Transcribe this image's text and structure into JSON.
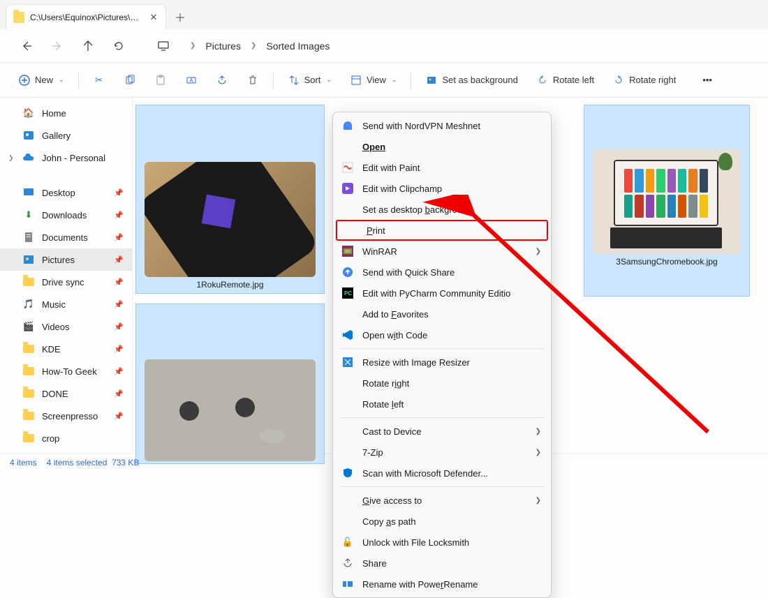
{
  "tab": {
    "title": "C:\\Users\\Equinox\\Pictures\\Sor"
  },
  "breadcrumb": {
    "seg1": "Pictures",
    "seg2": "Sorted Images"
  },
  "toolbar": {
    "new": "New",
    "sort": "Sort",
    "view": "View",
    "bg": "Set as background",
    "rotl": "Rotate left",
    "rotr": "Rotate right"
  },
  "side": {
    "home": "Home",
    "gallery": "Gallery",
    "john": "John - Personal",
    "desktop": "Desktop",
    "downloads": "Downloads",
    "documents": "Documents",
    "pictures": "Pictures",
    "drive": "Drive sync",
    "music": "Music",
    "videos": "Videos",
    "kde": "KDE",
    "htg": "How-To Geek",
    "done": "DONE",
    "sp": "Screenpresso",
    "crop": "crop"
  },
  "thumbs": {
    "roku": "1RokuRemote.jpg",
    "samsung": "3SamsungChromebook.jpg"
  },
  "status": {
    "items": "4 items",
    "sel": "4 items selected",
    "size": "733 KB"
  },
  "ctx": {
    "nordvpn": "Send with NordVPN Meshnet",
    "open": "Open",
    "paint": "Edit with Paint",
    "clip": "Edit with Clipchamp",
    "bg": "Set as desktop ",
    "bg2": "b",
    "bg3": "ackground",
    "print_p": "P",
    "print": "rint",
    "winrar": "WinRAR",
    "quick": "Send with Quick Share",
    "pycharm": "Edit with PyCharm Community Editio",
    "fav1": "Add to ",
    "fav_f": "F",
    "fav2": "avorites",
    "code1": "Open w",
    "code_i": "i",
    "code2": "th Code",
    "resize": "Resize with Image Resizer",
    "rotr1": "Rotate r",
    "rotr_i": "i",
    "rotr2": "ght",
    "rotl1": "Rotate ",
    "rotl_l": "l",
    "rotl2": "eft",
    "cast": "Cast to Device",
    "zip": "7-Zip",
    "defender": "Scan with Microsoft Defender...",
    "give1": "G",
    "give2": "ive access to",
    "copy1": "Copy ",
    "copy_a": "a",
    "copy2": "s path",
    "lock": "Unlock with File Locksmith",
    "share": "Share",
    "rename1": "Rename with Powe",
    "rename_r": "r",
    "rename2": "Rename"
  }
}
